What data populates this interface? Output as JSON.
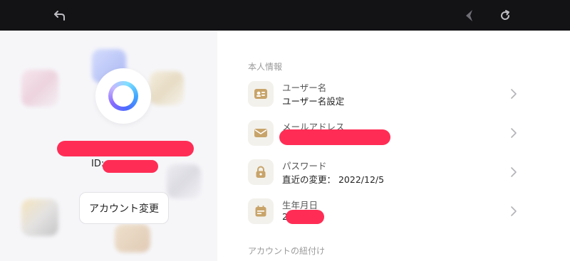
{
  "topbar": {
    "icons": [
      "back-arrow-icon",
      "pin-icon",
      "refresh-icon"
    ]
  },
  "profile": {
    "id_prefix": "ID:",
    "account_change_label": "アカウント変更"
  },
  "personal_info": {
    "section_title": "本人情報",
    "items": [
      {
        "title": "ユーザー名",
        "value": "ユーザー名設定",
        "icon": "id-card-icon"
      },
      {
        "title": "メールアドレス",
        "value": "",
        "icon": "mail-icon"
      },
      {
        "title": "パスワード",
        "value": "直近の変更： 2022/12/5",
        "icon": "lock-icon"
      },
      {
        "title": "生年月日",
        "value": "2",
        "icon": "calendar-icon"
      }
    ]
  },
  "linking": {
    "section_title": "アカウントの紐付け"
  },
  "colors": {
    "topbar_bg": "#131316",
    "left_bg": "#f6f6f9",
    "icon_gold": "#c8a46a",
    "redaction": "#ff2d55"
  }
}
